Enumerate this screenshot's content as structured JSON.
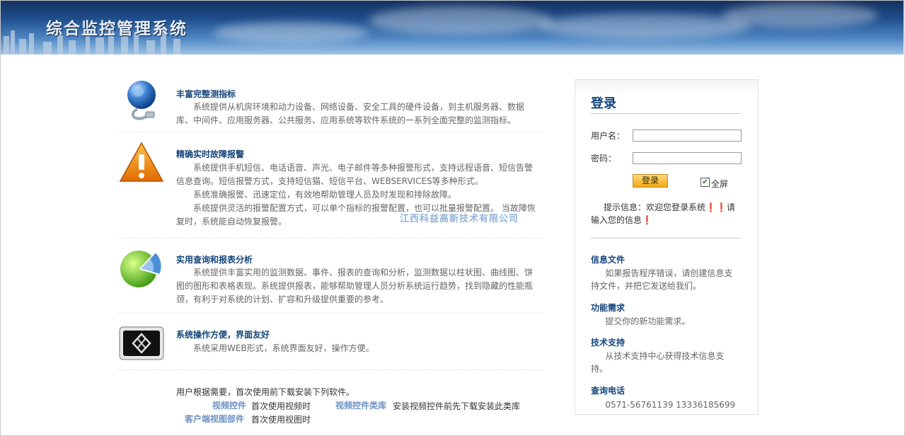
{
  "header": {
    "title": "综合监控管理系统"
  },
  "features": [
    {
      "title": "丰富完整测指标",
      "paragraphs": [
        "系统提供从机房环境和动力设备、网络设备、安全工具的硬件设备，到主机服务器、数据库、中间件、应用服务器、公共服务、应用系统等软件系统的一系列全面完整的监测指标。"
      ]
    },
    {
      "title": "精确实时故障报警",
      "paragraphs": [
        "系统提供手机短信、电话语音、声光、电子邮件等多种报警形式，支持远程语音、短信告警信息查询。短信报警方式，支持短信猫、短信平台、WEBSERVICES等多种形式。",
        "系统准确报警、迅速定位，有效地帮助管理人员及时发现和排除故障。",
        "系统提供灵活的报警配置方式，可以单个指标的报警配置，也可以批量报警配置。 当故障恢复时，系统能自动恢复报警。"
      ]
    },
    {
      "title": "实用查询和报表分析",
      "paragraphs": [
        "系统提供丰富实用的监测数据、事件、报表的查询和分析，监测数据以柱状图、曲线图、饼图的图形和表格表现。系统提供报表，能够帮助管理人员分析系统运行趋势，找到隐藏的性能瓶颈，有利于对系统的计划、扩容和升级提供重要的参考。"
      ]
    },
    {
      "title": "系统操作方便，界面友好",
      "paragraphs": [
        "系统采用WEB形式，系统界面友好，操作方便。"
      ]
    }
  ],
  "watermark": "江西科益高新技术有限公司",
  "download": {
    "intro": "用户根据需要，首次使用前下载安装下列软件。",
    "items": [
      {
        "link": "视频控件",
        "desc": "首次使用视频时"
      },
      {
        "link": "视频控件类库",
        "desc": "安装视频控件前先下载安装此类库"
      },
      {
        "link": "客户端视图部件",
        "desc": "首次使用视图时"
      }
    ]
  },
  "login": {
    "title": "登录",
    "username_label": "用户名：",
    "username_value": "",
    "password_label": "密码：",
    "password_value": "",
    "submit_label": "登录",
    "fullscreen_label": "全屏",
    "fullscreen_checked": true,
    "tip": "提示信息：欢迎您登录系统❗❗请输入您的信息❗"
  },
  "info": [
    {
      "title": "信息文件",
      "text": "如果报告程序错误，请创建信息支持文件，并把它发送给我们。"
    },
    {
      "title": "功能需求",
      "text": "提交你的新功能需求。"
    },
    {
      "title": "技术支持",
      "text": "从技术支持中心获得技术信息支持。"
    },
    {
      "title": "查询电话",
      "text": "0571-56761139  13336185699"
    }
  ],
  "colors": {
    "accent": "#14457c",
    "link": "#6e93c4",
    "button": "#f1a91a",
    "alert_icon": "#f07d00"
  }
}
